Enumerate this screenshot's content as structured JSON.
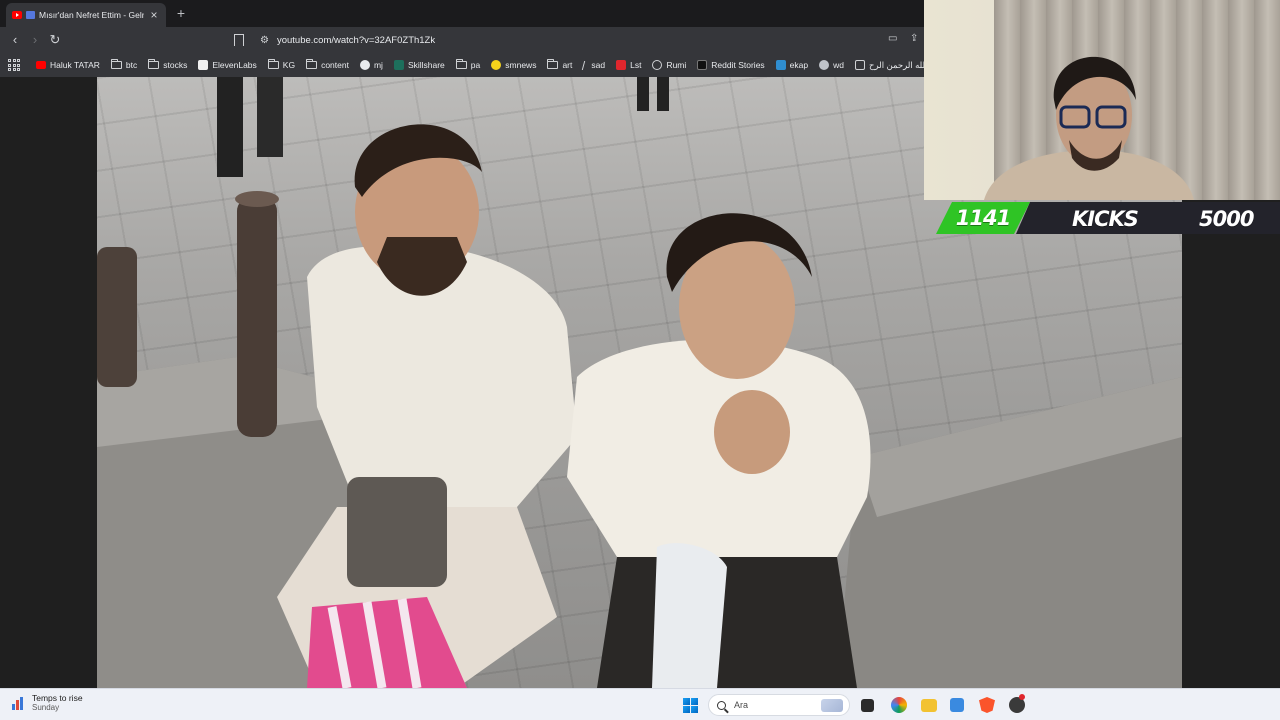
{
  "browser": {
    "tab_title": "Mısır'dan Nefret Ettim - Gelmeyin",
    "url": "youtube.com/watch?v=32AF0ZTh1Zk",
    "bookmarks": [
      {
        "label": "Haluk TATAR",
        "icon": "youtube-icon"
      },
      {
        "label": "btc",
        "icon": "folder-icon"
      },
      {
        "label": "stocks",
        "icon": "folder-icon"
      },
      {
        "label": "ElevenLabs",
        "icon": "elevenlabs-icon"
      },
      {
        "label": "KG",
        "icon": "folder-icon"
      },
      {
        "label": "content",
        "icon": "folder-icon"
      },
      {
        "label": "mj",
        "icon": "github-icon"
      },
      {
        "label": "Skillshare",
        "icon": "skillshare-icon"
      },
      {
        "label": "pa",
        "icon": "folder-icon"
      },
      {
        "label": "smnews",
        "icon": "smiley-icon"
      },
      {
        "label": "art",
        "icon": "folder-icon"
      },
      {
        "label": "sad",
        "icon": "slash-icon"
      },
      {
        "label": "Lst",
        "icon": "s-icon"
      },
      {
        "label": "Rumi",
        "icon": "globe-icon"
      },
      {
        "label": "Reddit Stories",
        "icon": "d-icon"
      },
      {
        "label": "ekap",
        "icon": "ekap-icon"
      },
      {
        "label": "wd",
        "icon": "wd-icon"
      },
      {
        "label": "الله الرحمن الرح...",
        "icon": "page-icon"
      }
    ]
  },
  "overlay": {
    "kicks_count": "1141",
    "kicks_label": "KICKS",
    "kicks_goal": "5000",
    "kicks_progress": 0.2282
  },
  "taskbar": {
    "weather_title": "Temps to rise",
    "weather_day": "Sunday",
    "search_placeholder": "Ara"
  },
  "colors": {
    "kicks_green": "#2fc425",
    "kicks_dark": "#23232b",
    "taskbar_bg": "#eef1f7"
  }
}
